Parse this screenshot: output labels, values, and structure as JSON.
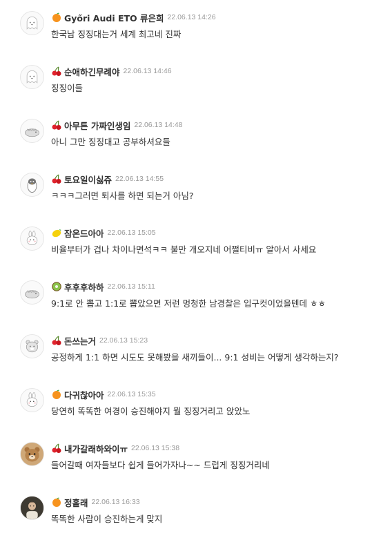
{
  "comments": [
    {
      "level_icon": "orange-icon",
      "nickname": "Győri Audi ETO 류은희",
      "date": "22.06.13 14:26",
      "text": "한국남 징징대는거 세계 최고네 진짜",
      "avatar": "default-ghost-avatar"
    },
    {
      "level_icon": "cherry-icon",
      "nickname": "순애하긴무례야",
      "date": "22.06.13 14:46",
      "text": "징징이들",
      "avatar": "default-ghost-avatar"
    },
    {
      "level_icon": "cherry-icon",
      "nickname": "아무튼 가짜인생임",
      "date": "22.06.13 14:48",
      "text": "아니 그만 징징대고 공부하셔요들",
      "avatar": "dino-avatar"
    },
    {
      "level_icon": "cherry-icon",
      "nickname": "토요일이싫쥬",
      "date": "22.06.13 14:55",
      "text": "ㅋㅋㅋ그러면 퇴사를 하면 되는거 아님?",
      "avatar": "penguin-avatar"
    },
    {
      "level_icon": "lemon-icon",
      "nickname": "잠온드아아",
      "date": "22.06.13 15:05",
      "text": "비율부터가 겁나 차이나면석ㅋㅋ 불만 개오지네 어쩔티비ㅠ 알아서 사세요",
      "avatar": "bunny-avatar"
    },
    {
      "level_icon": "kiwi-icon",
      "nickname": "후후후하하",
      "date": "22.06.13 15:11",
      "text": "9:1로 안 뽑고 1:1로 뽑았으면 저런 멍청한 남경찰은 입구컷이었을텐데 ㅎㅎ",
      "avatar": "dino-avatar"
    },
    {
      "level_icon": "cherry-icon",
      "nickname": "돈쓰는거",
      "date": "22.06.13 15:23",
      "text": "공정하게 1:1 하면 시도도 못해봤을 새끼들이... 9:1 성비는 어떻게 생각하는지?",
      "avatar": "bear-avatar"
    },
    {
      "level_icon": "orange-icon",
      "nickname": "다귀찮아아",
      "date": "22.06.13 15:35",
      "text": "당연히 똑똑한 여경이 승진해야지 뭘 징징거리고 앉았노",
      "avatar": "bunny-avatar"
    },
    {
      "level_icon": "cherry-icon",
      "nickname": "내가갈래하와이ㅠ",
      "date": "22.06.13 15:38",
      "text": "들어갈때 여자들보다 쉽게 들어가자나~~ 드럽게 징징거리네",
      "avatar": "plush-photo-avatar"
    },
    {
      "level_icon": "orange-icon",
      "nickname": "정홀래",
      "date": "22.06.13 16:33",
      "text": "똑똑한 사람이 승진하는게 맞지",
      "avatar": "person-photo-avatar"
    }
  ],
  "colors": {
    "nickname": "#333333",
    "date": "#999999",
    "text": "#333333",
    "avatar_border": "#e6e6e6"
  }
}
